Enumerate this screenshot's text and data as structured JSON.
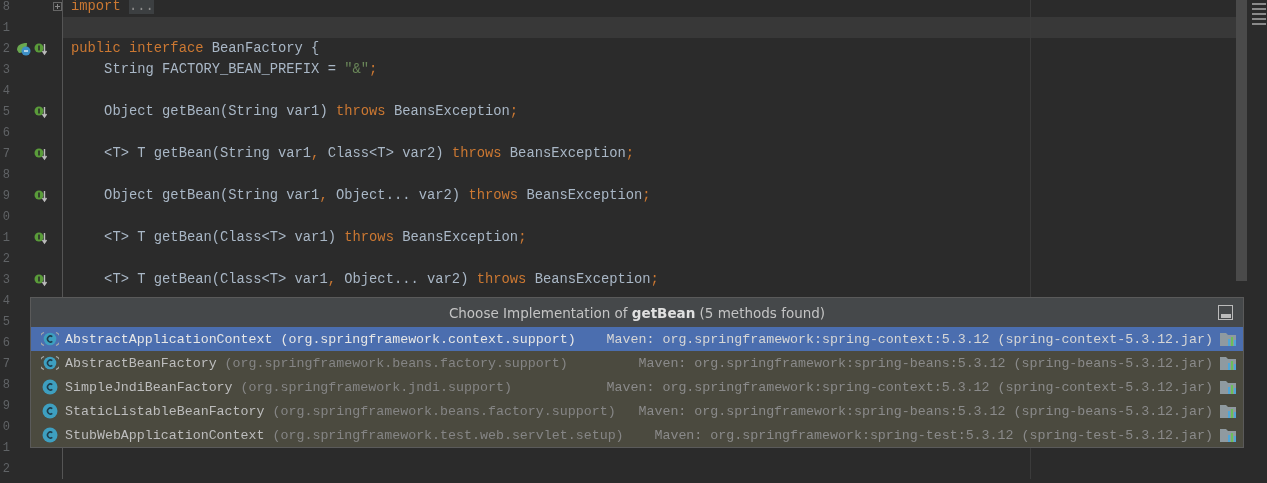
{
  "editor": {
    "lines": [
      {
        "number": "8",
        "folded": true,
        "tokens": [
          {
            "kind": "keyword",
            "text": "import"
          },
          {
            "kind": "placeholder",
            "text": "..."
          }
        ]
      },
      {
        "number": "1",
        "current": true
      },
      {
        "number": "2",
        "gutter_icons": [
          {
            "kind": "bean"
          },
          {
            "kind": "implemented"
          }
        ],
        "tokens": [
          {
            "kind": "keyword",
            "text": "public interface"
          },
          {
            "kind": "plain",
            "text": " BeanFactory {"
          }
        ]
      },
      {
        "number": "3",
        "tokens": [
          {
            "kind": "plain",
            "text": "    String FACTORY_BEAN_PREFIX = "
          },
          {
            "kind": "string",
            "text": "\"&\""
          },
          {
            "kind": "keyword",
            "text": ";"
          }
        ]
      },
      {
        "number": "4"
      },
      {
        "number": "5",
        "gutter_icons": [
          {
            "kind": "implemented"
          }
        ],
        "tokens": [
          {
            "kind": "plain",
            "text": "    Object getBean(String var1) "
          },
          {
            "kind": "keyword",
            "text": "throws"
          },
          {
            "kind": "plain",
            "text": " BeansException"
          },
          {
            "kind": "keyword",
            "text": ";"
          }
        ]
      },
      {
        "number": "6"
      },
      {
        "number": "7",
        "gutter_icons": [
          {
            "kind": "implemented"
          }
        ],
        "tokens": [
          {
            "kind": "plain",
            "text": "    <T> T getBean(String var1"
          },
          {
            "kind": "keyword",
            "text": ","
          },
          {
            "kind": "plain",
            "text": " Class<T> var2) "
          },
          {
            "kind": "keyword",
            "text": "throws"
          },
          {
            "kind": "plain",
            "text": " BeansException"
          },
          {
            "kind": "keyword",
            "text": ";"
          }
        ]
      },
      {
        "number": "8"
      },
      {
        "number": "9",
        "gutter_icons": [
          {
            "kind": "implemented"
          }
        ],
        "tokens": [
          {
            "kind": "plain",
            "text": "    Object getBean(String var1"
          },
          {
            "kind": "keyword",
            "text": ","
          },
          {
            "kind": "plain",
            "text": " Object... var2) "
          },
          {
            "kind": "keyword",
            "text": "throws"
          },
          {
            "kind": "plain",
            "text": " BeansException"
          },
          {
            "kind": "keyword",
            "text": ";"
          }
        ]
      },
      {
        "number": "0"
      },
      {
        "number": "1",
        "gutter_icons": [
          {
            "kind": "implemented"
          }
        ],
        "tokens": [
          {
            "kind": "plain",
            "text": "    <T> T getBean(Class<T> var1) "
          },
          {
            "kind": "keyword",
            "text": "throws"
          },
          {
            "kind": "plain",
            "text": " BeansException"
          },
          {
            "kind": "keyword",
            "text": ";"
          }
        ]
      },
      {
        "number": "2"
      },
      {
        "number": "3",
        "gutter_icons": [
          {
            "kind": "implemented"
          }
        ],
        "tokens": [
          {
            "kind": "plain",
            "text": "    <T> T getBean(Class<T> var1"
          },
          {
            "kind": "keyword",
            "text": ","
          },
          {
            "kind": "plain",
            "text": " Object... var2) "
          },
          {
            "kind": "keyword",
            "text": "throws"
          },
          {
            "kind": "plain",
            "text": " BeansException"
          },
          {
            "kind": "keyword",
            "text": ";"
          }
        ]
      },
      {
        "number": "4"
      },
      {
        "number": "5"
      },
      {
        "number": "6"
      },
      {
        "number": "7"
      },
      {
        "number": "8"
      },
      {
        "number": "9"
      },
      {
        "number": "0"
      },
      {
        "number": "1"
      },
      {
        "number": "2"
      }
    ]
  },
  "popup": {
    "title": "Choose Implementation of **getBean** (5 methods found)",
    "rows": [
      {
        "kind": "abstract",
        "name": "AbstractApplicationContext",
        "package": "(org.springframework.context.support)",
        "library": "Maven: org.springframework:spring-context:5.3.12 (spring-context-5.3.12.jar)",
        "selected": true
      },
      {
        "kind": "abstract",
        "name": "AbstractBeanFactory",
        "package": "(org.springframework.beans.factory.support)",
        "library": "Maven: org.springframework:spring-beans:5.3.12 (spring-beans-5.3.12.jar)",
        "selected": false
      },
      {
        "kind": "class",
        "name": "SimpleJndiBeanFactory",
        "package": "(org.springframework.jndi.support)",
        "library": "Maven: org.springframework:spring-context:5.3.12 (spring-context-5.3.12.jar)",
        "selected": false
      },
      {
        "kind": "class",
        "name": "StaticListableBeanFactory",
        "package": "(org.springframework.beans.factory.support)",
        "library": "Maven: org.springframework:spring-beans:5.3.12 (spring-beans-5.3.12.jar)",
        "selected": false
      },
      {
        "kind": "class",
        "name": "StubWebApplicationContext",
        "package": "(org.springframework.test.web.servlet.setup)",
        "library": "Maven: org.springframework:spring-test:5.3.12 (spring-test-5.3.12.jar)",
        "selected": false
      }
    ]
  }
}
